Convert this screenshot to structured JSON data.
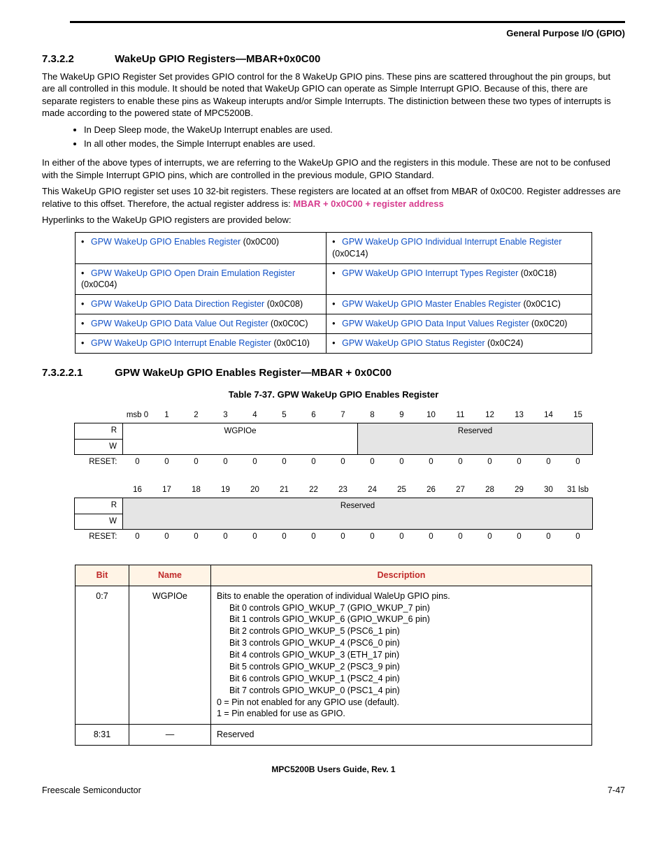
{
  "header": {
    "chapter": "General Purpose I/O (GPIO)"
  },
  "sec": {
    "num": "7.3.2.2",
    "title": "WakeUp GPIO Registers—MBAR+0x0C00",
    "para1": "The WakeUp GPIO Register Set provides GPIO control for the 8 WakeUp GPIO pins. These pins are scattered throughout the pin groups, but are all controlled in this module. It should be noted that WakeUp GPIO can operate as Simple Interrupt GPIO. Because of this, there are separate registers to enable these pins as Wakeup interupts and/or Simple Interrupts. The distiniction between these two types of interrupts is made according to the powered state of MPC5200B.",
    "bul1": "In Deep Sleep mode, the WakeUp Interrupt enables are used.",
    "bul2": "In all other modes, the Simple Interrupt enables are used.",
    "para2": "In either of the above types of interrupts, we are referring to the WakeUp GPIO and the registers in this module. These are not to be confused with the Simple Interrupt GPIO pins, which are controlled in the previous module, GPIO Standard.",
    "para3a": "This WakeUp GPIO register set uses 10 32-bit registers. These registers are located at an offset from MBAR of 0x0C00. Register addresses are relative to this offset. Therefore, the actual register address is: ",
    "para3b": "MBAR + 0x0C00 + register address",
    "para4": "Hyperlinks to the WakeUp GPIO registers are provided below:"
  },
  "links": {
    "l1": "GPW WakeUp GPIO Enables Register",
    "o1": " (0x0C00)",
    "l2": "GPW WakeUp GPIO Open Drain Emulation Register",
    "o2": "(0x0C04)",
    "l3": "GPW WakeUp GPIO Data Direction Register",
    "o3": " (0x0C08)",
    "l4": "GPW WakeUp GPIO Data Value Out Register",
    "o4": " (0x0C0C)",
    "l5": "GPW WakeUp GPIO Interrupt Enable Register",
    "o5": " (0x0C10)",
    "r1": "GPW WakeUp GPIO Individual Interrupt Enable Register",
    "ro1": "(0x0C14)",
    "r2": "GPW WakeUp GPIO Interrupt Types Register",
    "ro2": " (0x0C18)",
    "r3": "GPW WakeUp GPIO Master Enables Register",
    "ro3": " (0x0C1C)",
    "r4": "GPW WakeUp GPIO Data Input Values Register",
    "ro4": " (0x0C20)",
    "r5": "GPW WakeUp GPIO Status Register",
    "ro5": " (0x0C24)"
  },
  "subsec": {
    "num": "7.3.2.2.1",
    "title": "GPW WakeUp GPIO Enables Register—MBAR + 0x0C00",
    "caption": "Table 7-37. GPW WakeUp GPIO Enables Register"
  },
  "bits": {
    "msb": "msb 0",
    "b1": "1",
    "b2": "2",
    "b3": "3",
    "b4": "4",
    "b5": "5",
    "b6": "6",
    "b7": "7",
    "b8": "8",
    "b9": "9",
    "b10": "10",
    "b11": "11",
    "b12": "12",
    "b13": "13",
    "b14": "14",
    "b15": "15",
    "r": "R",
    "w": "W",
    "reset": "RESET:",
    "field_wgpio": "WGPIOe",
    "field_res": "Reserved",
    "zero": "0",
    "b16": "16",
    "b17": "17",
    "b18": "18",
    "b19": "19",
    "b20": "20",
    "b21": "21",
    "b22": "22",
    "b23": "23",
    "b24": "24",
    "b25": "25",
    "b26": "26",
    "b27": "27",
    "b28": "28",
    "b29": "29",
    "b30": "30",
    "lsb": "31 lsb"
  },
  "desc": {
    "h_bit": "Bit",
    "h_name": "Name",
    "h_desc": "Description",
    "row1_bit": "0:7",
    "row1_name": "WGPIOe",
    "row1_l0": "Bits to enable the operation of individual WaleUp GPIO pins.",
    "row1_l1": "Bit 0 controls GPIO_WKUP_7 (GPIO_WKUP_7 pin)",
    "row1_l2": "Bit 1 controls GPIO_WKUP_6 (GPIO_WKUP_6 pin)",
    "row1_l3": "Bit 2 controls GPIO_WKUP_5 (PSC6_1 pin)",
    "row1_l4": "Bit 3 controls GPIO_WKUP_4 (PSC6_0 pin)",
    "row1_l5": "Bit 4 controls GPIO_WKUP_3 (ETH_17 pin)",
    "row1_l6": "Bit 5 controls GPIO_WKUP_2 (PSC3_9 pin)",
    "row1_l7": "Bit 6 controls GPIO_WKUP_1 (PSC2_4 pin)",
    "row1_l8": "Bit 7 controls GPIO_WKUP_0 (PSC1_4 pin)",
    "row1_l9": "0 = Pin not enabled for any GPIO use (default).",
    "row1_l10": "1 = Pin enabled for use as GPIO.",
    "row2_bit": "8:31",
    "row2_name": "—",
    "row2_desc": "Reserved"
  },
  "footer": {
    "center": "MPC5200B Users Guide, Rev. 1",
    "left": "Freescale Semiconductor",
    "right": "7-47"
  }
}
